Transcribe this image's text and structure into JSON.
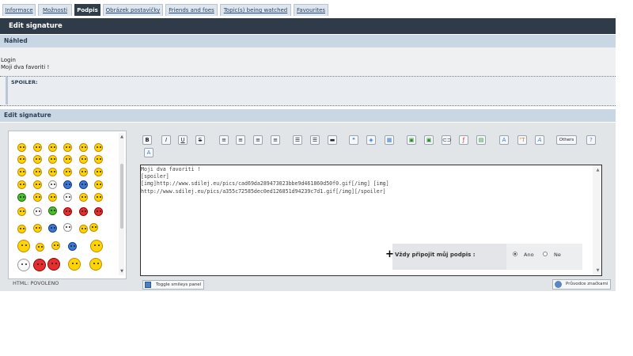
{
  "tabs": [
    {
      "label": "Informace"
    },
    {
      "label": "Možnosti"
    },
    {
      "label": "Podpis"
    },
    {
      "label": "Obrázek postavičky"
    },
    {
      "label": "Friends and foes"
    },
    {
      "label": "Topic(s) being watched"
    },
    {
      "label": "Favourites"
    }
  ],
  "active_tab": "Podpis",
  "title": "Edit signature",
  "preview": {
    "heading": "Náhled",
    "line1": "Login",
    "line2": "Moji dva favoriti !",
    "spoiler_label": "SPOILER:"
  },
  "edit": {
    "heading": "Edit signature",
    "html_status": "HTML: POVOLENO",
    "textarea_text": "Moji dva favoriti !\n[spoiler]\n[img]http://www.sdilej.eu/pics/cad69da289473023bbe9d461860d50f0.gif[/img] [img]\nhttp://www.sdilej.eu/pics/a355c72585dec0ed126851d94239c7d1.gif[/img][/spoiler]",
    "always_attach_label": "Vždy připojit můj podpis :",
    "option_yes": "Ano",
    "option_no": "Ne",
    "selected_option": "Ano",
    "toggle_smileys": "Toggle smileys panel",
    "guide": "Průvodce značkami"
  },
  "toolbar": {
    "bold": "B",
    "italic": "I",
    "underline": "U",
    "strike": "S",
    "others": "Others",
    "az": "A"
  },
  "colors": {
    "title_bar": "#303b49",
    "section_head": "#c9d6e4",
    "tab_active": "#303d4a"
  }
}
